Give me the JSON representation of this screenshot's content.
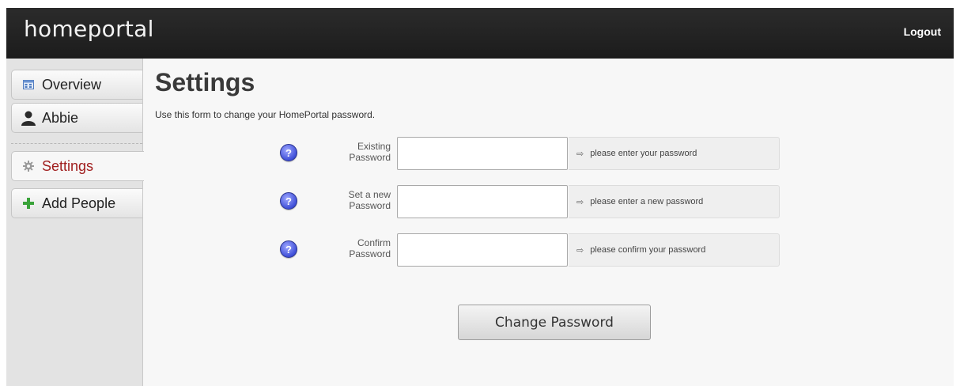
{
  "header": {
    "logo": "homeportal",
    "logout_label": "Logout"
  },
  "sidebar": {
    "items": [
      {
        "label": "Overview",
        "icon": "overview-grid-icon",
        "active": false
      },
      {
        "label": "Abbie",
        "icon": "person-icon",
        "active": false
      },
      {
        "label": "Settings",
        "icon": "gear-icon",
        "active": true
      },
      {
        "label": "Add People",
        "icon": "plus-icon",
        "active": false
      }
    ]
  },
  "main": {
    "title": "Settings",
    "intro": "Use this form to change your HomePortal password.",
    "fields": [
      {
        "label_line1": "Existing",
        "label_line2": "Password",
        "value": "",
        "hint": "please enter your password"
      },
      {
        "label_line1": "Set a new",
        "label_line2": "Password",
        "value": "",
        "hint": "please enter a new password"
      },
      {
        "label_line1": "Confirm",
        "label_line2": "Password",
        "value": "",
        "hint": "please confirm your password"
      }
    ],
    "help_glyph": "?",
    "hint_arrow": "⇨",
    "submit_label": "Change Password"
  },
  "colors": {
    "header_bg": "#222222",
    "active_nav_text": "#a01e1e",
    "help_icon": "#4a58e0",
    "add_icon": "#3aa33a"
  }
}
